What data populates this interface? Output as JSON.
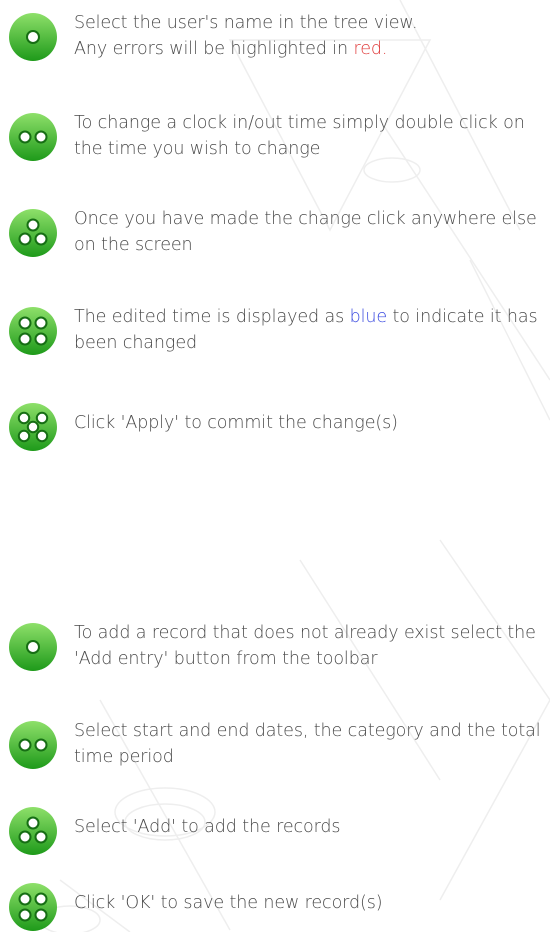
{
  "steps_a": [
    {
      "dots": 1,
      "text_before": "Select the user's name in the tree view.",
      "line2_before": "Any errors will be highlighted in ",
      "highlight": "red."
    },
    {
      "dots": 2,
      "text": "To change a clock in/out time simply double click on the time you wish to change"
    },
    {
      "dots": 3,
      "text": "Once you have made the change click anywhere else on the screen"
    },
    {
      "dots": 4,
      "text_before": "The edited time is displayed as ",
      "highlight": "blue",
      "text_after": " to indicate it has been changed"
    },
    {
      "dots": 5,
      "text": "Click 'Apply' to commit the change(s)"
    }
  ],
  "steps_b": [
    {
      "dots": 1,
      "text": "To add a record that does not already exist select the 'Add entry' button from the toolbar"
    },
    {
      "dots": 2,
      "text": "Select start and end dates, the category and the total time period"
    },
    {
      "dots": 3,
      "text": "Select 'Add' to add the records"
    },
    {
      "dots": 4,
      "text": "Click 'OK' to save the new record(s)"
    }
  ],
  "colors": {
    "badge_top": "#8ee06a",
    "badge_bottom": "#1e9a1a",
    "error": "#e03b3b",
    "edited": "#3b4be0"
  }
}
